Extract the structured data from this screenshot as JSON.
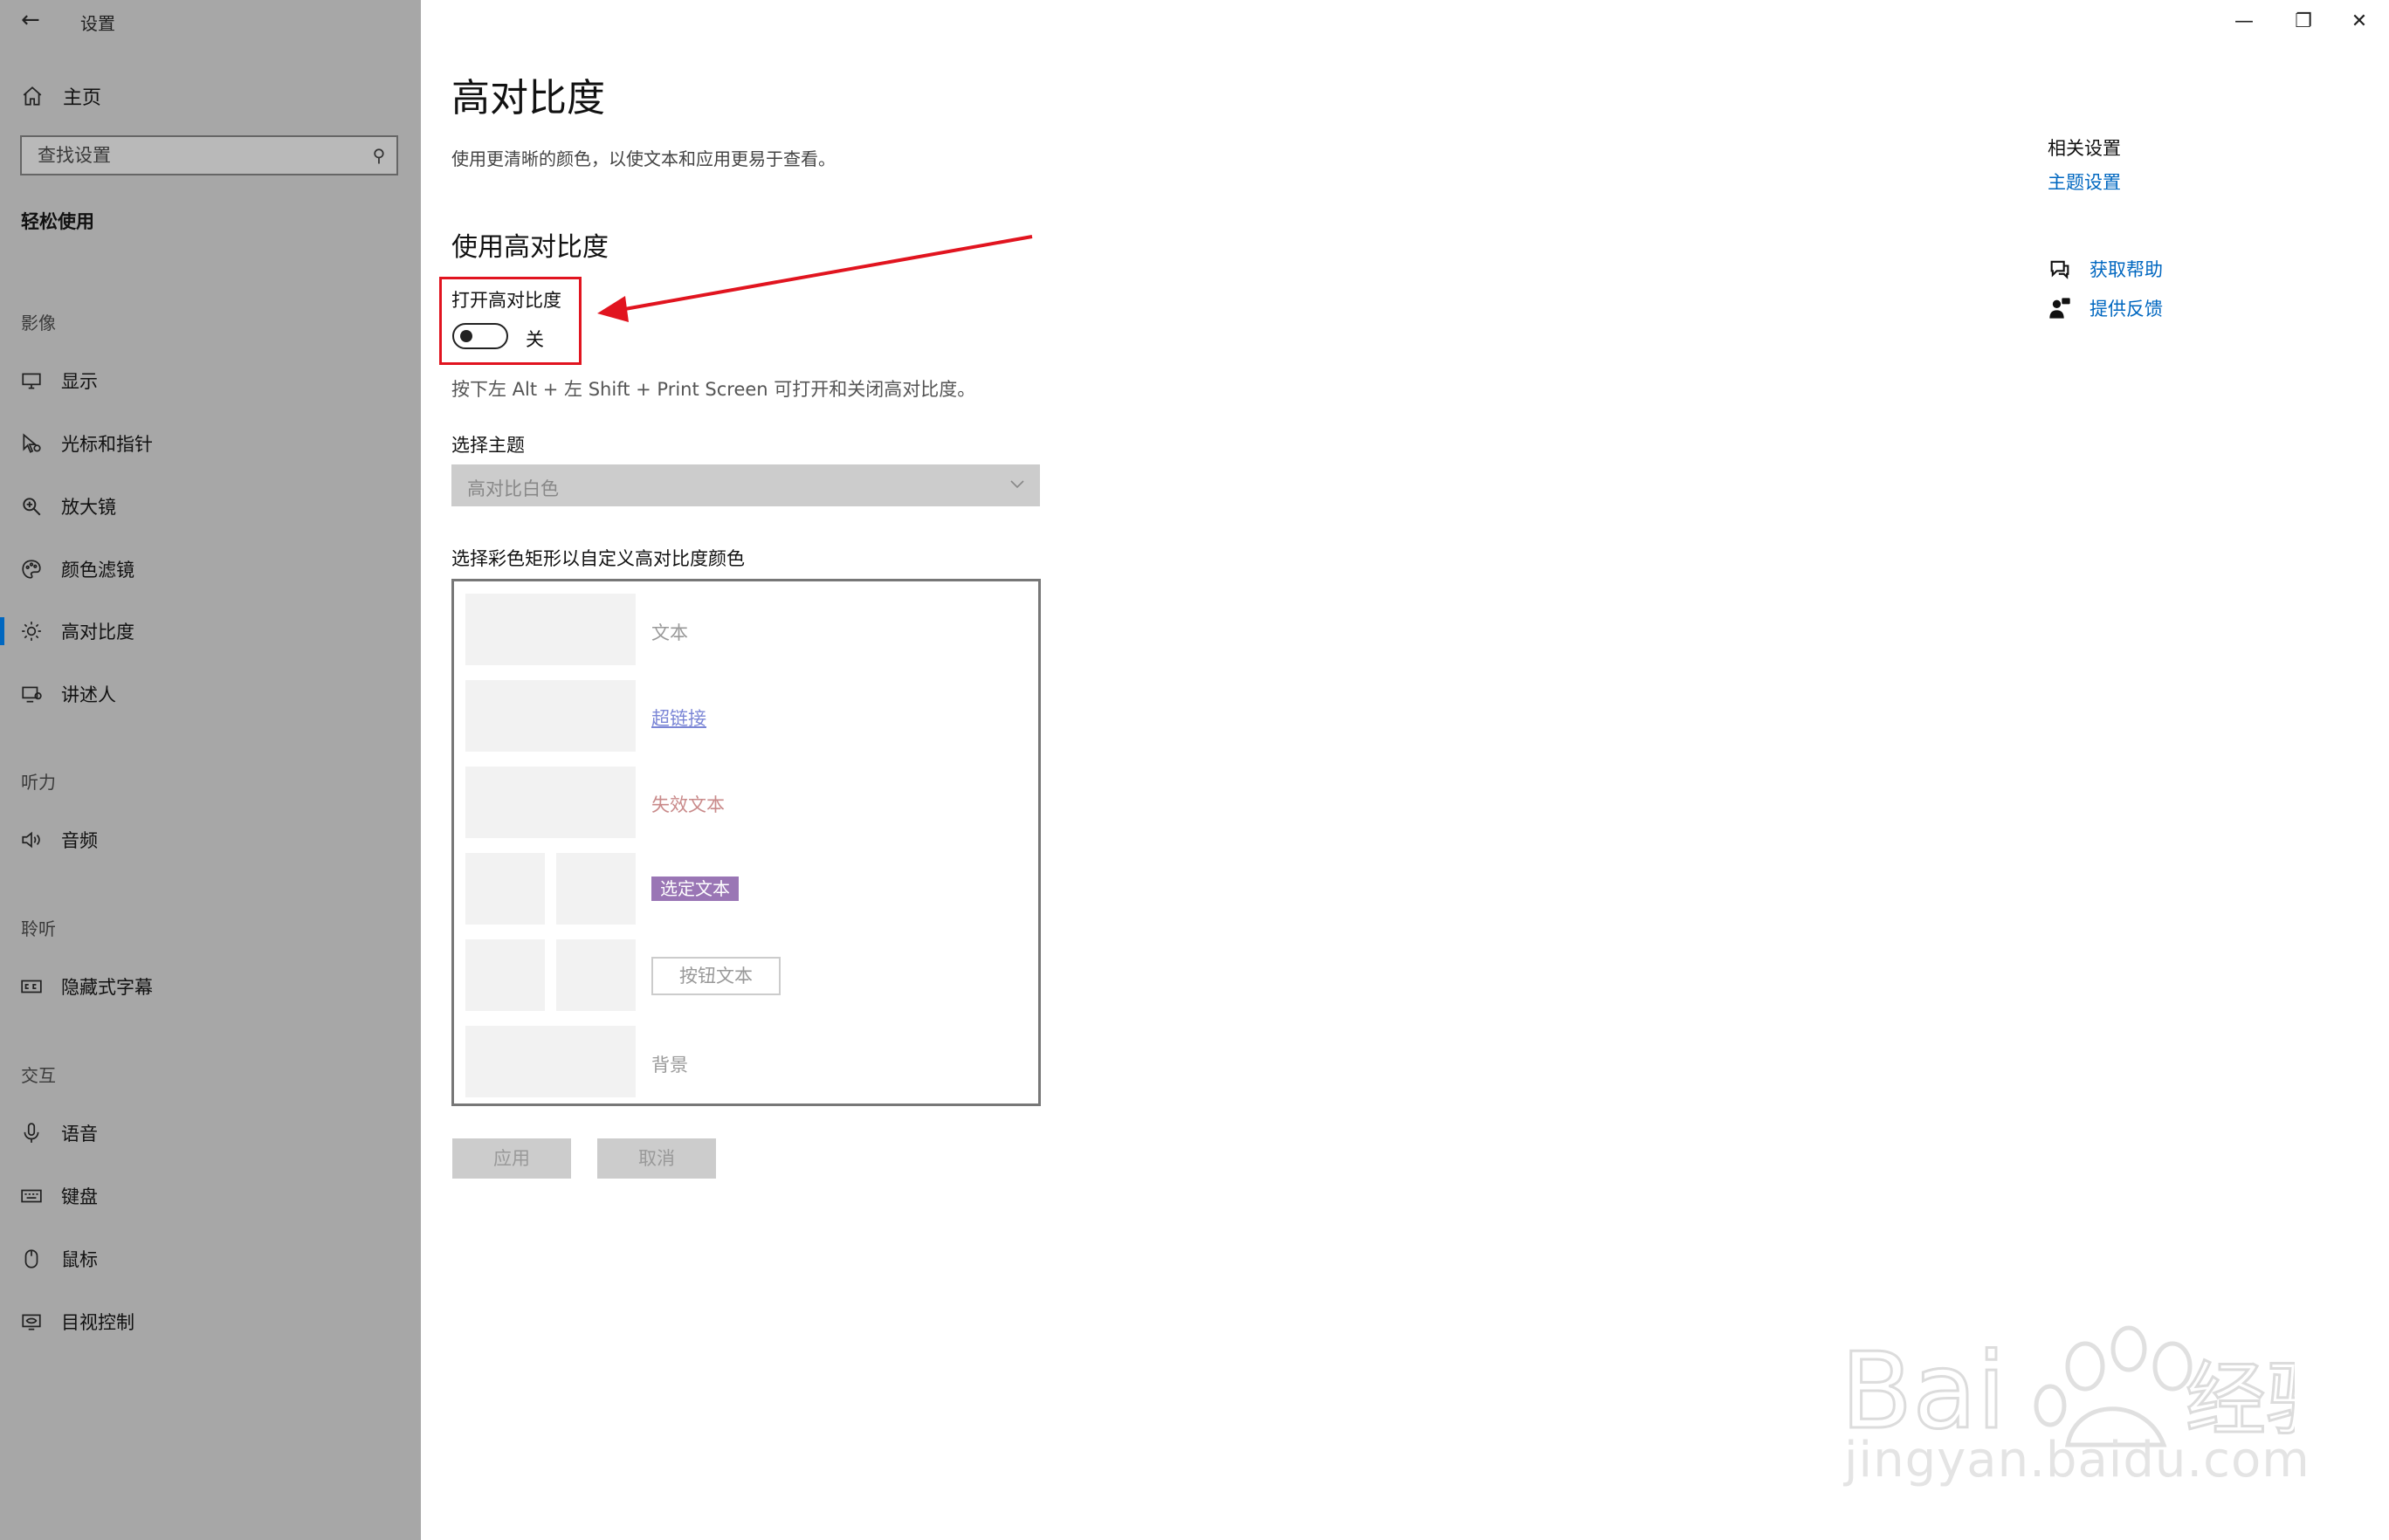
{
  "app": {
    "title": "设置",
    "back_icon": "back-arrow-icon"
  },
  "window_controls": {
    "minimize": "—",
    "restore": "❐",
    "close": "✕"
  },
  "sidebar": {
    "home_label": "主页",
    "search_placeholder": "查找设置",
    "section_heading": "轻松使用",
    "groups": {
      "vision": "影像",
      "hearing": "听力",
      "listening": "聆听",
      "interaction": "交互"
    },
    "items": {
      "display": "显示",
      "cursor": "光标和指针",
      "magnifier": "放大镜",
      "color_filters": "颜色滤镜",
      "high_contrast": "高对比度",
      "narrator": "讲述人",
      "audio": "音频",
      "captions": "隐藏式字幕",
      "speech": "语音",
      "keyboard": "键盘",
      "mouse": "鼠标",
      "eye_control": "目视控制"
    },
    "active_item": "high_contrast"
  },
  "main": {
    "title": "高对比度",
    "description": "使用更清晰的颜色，以使文本和应用更易于查看。",
    "section_title": "使用高对比度",
    "toggle_label": "打开高对比度",
    "toggle_state": "关",
    "toggle_on": false,
    "hint": "按下左 Alt + 左 Shift + Print Screen 可打开和关闭高对比度。",
    "theme_label": "选择主题",
    "theme_value": "高对比白色",
    "custom_label": "选择彩色矩形以自定义高对比度颜色",
    "swatches": {
      "text": "文本",
      "hyperlink": "超链接",
      "disabled_text": "失效文本",
      "selected_text": "选定文本",
      "button_text": "按钮文本",
      "background": "背景"
    },
    "apply_button": "应用",
    "cancel_button": "取消"
  },
  "related": {
    "title": "相关设置",
    "theme_link": "主题设置",
    "get_help": "获取帮助",
    "feedback": "提供反馈"
  },
  "watermark": {
    "logo": "Bai 经验",
    "url": "jingyan.baidu.com"
  },
  "colors": {
    "sidebar_bg": "#a7a7a7",
    "accent": "#0067c0",
    "highlight_red": "#e1141f",
    "hyperlink_sample": "#7b86d6",
    "disabled_sample": "#c98a8a",
    "selected_bg": "#9a76b5"
  }
}
